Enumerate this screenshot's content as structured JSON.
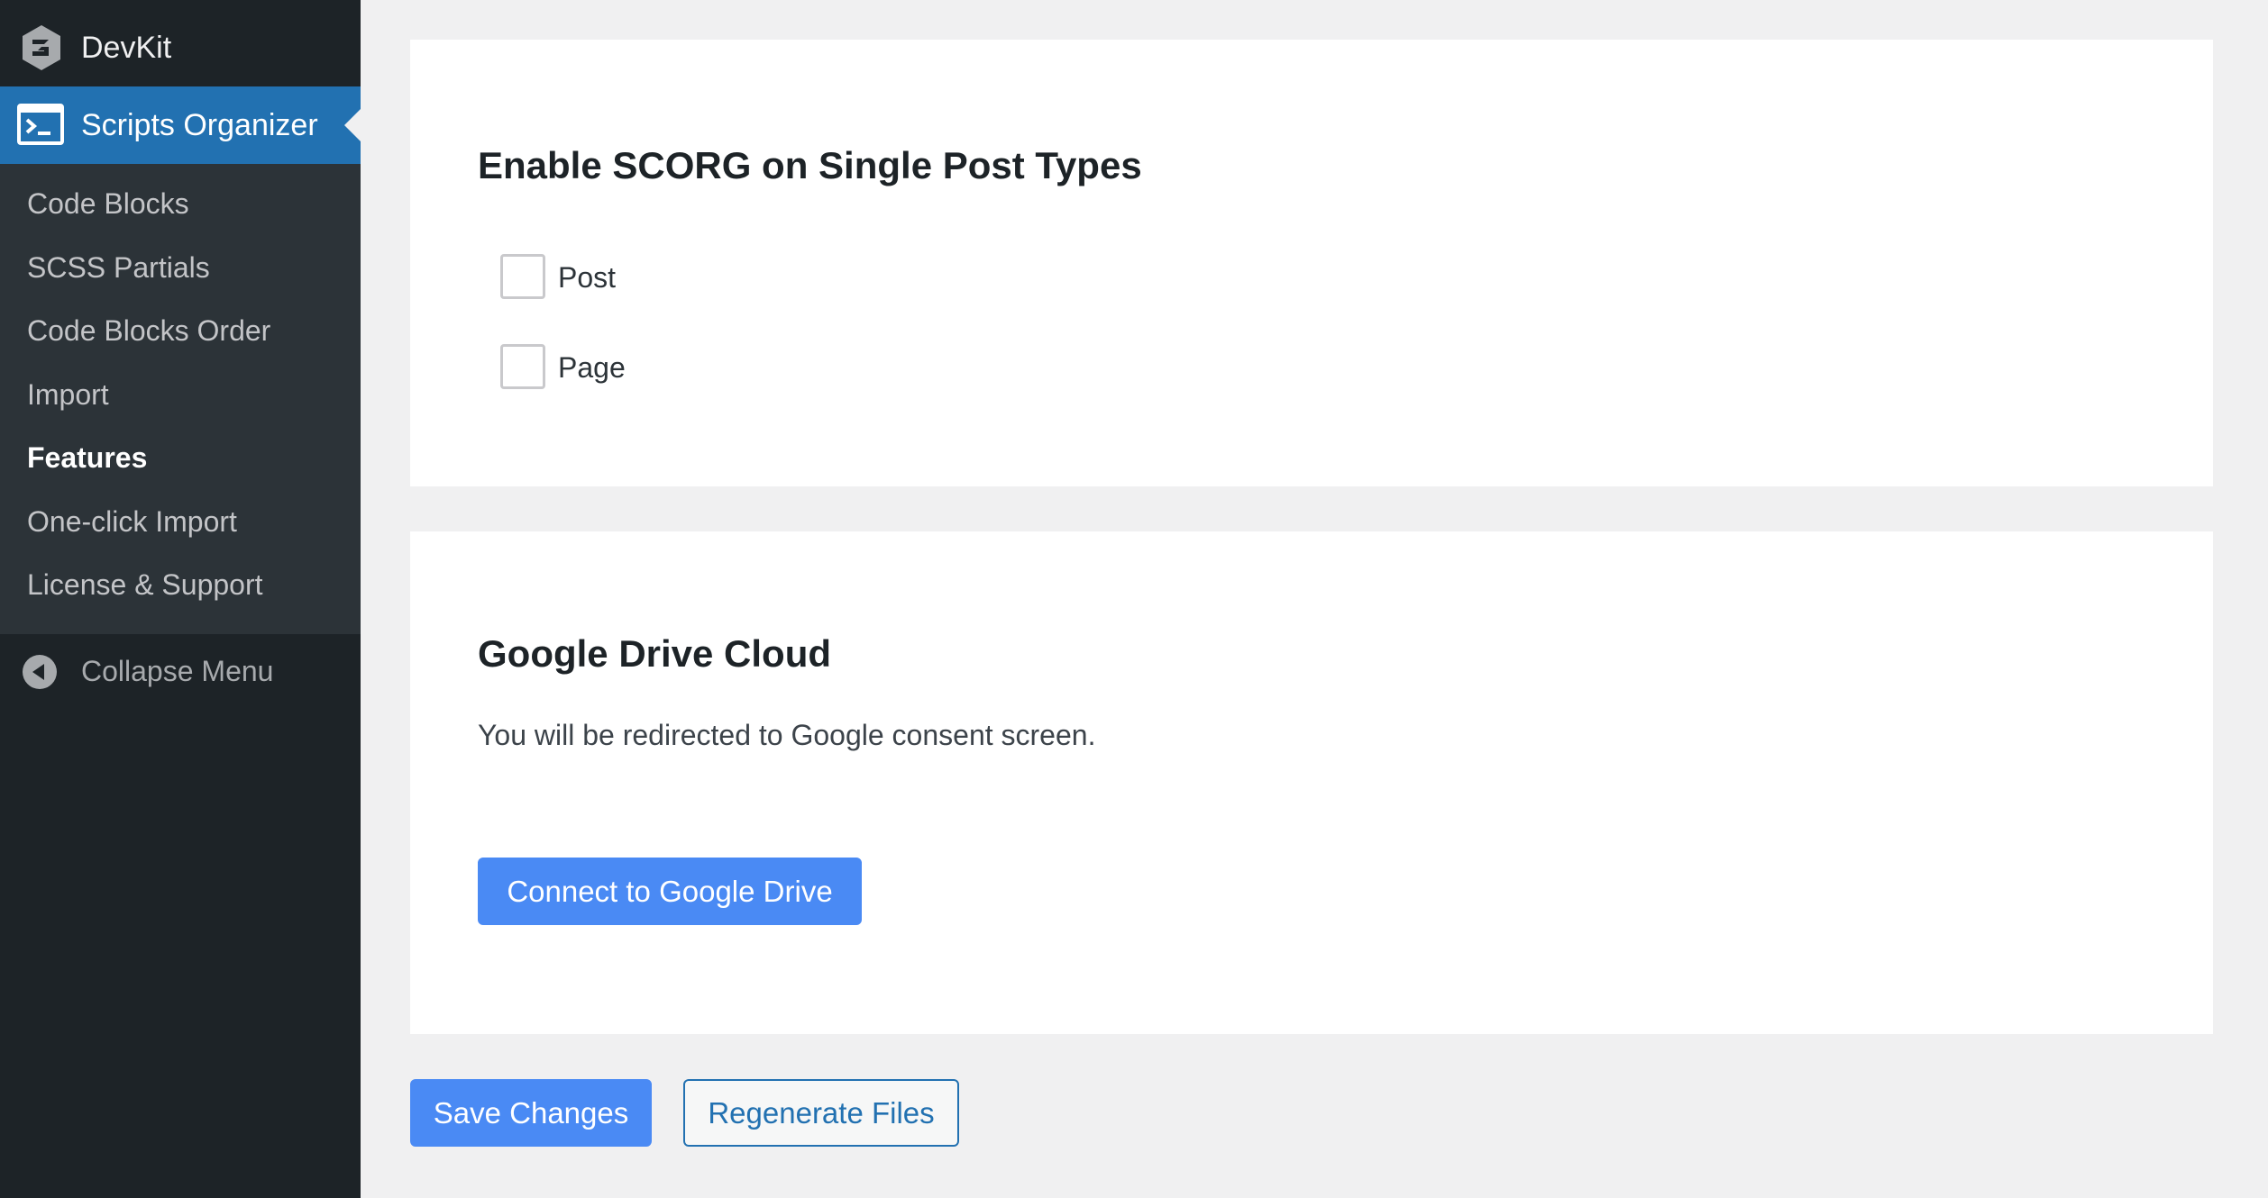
{
  "sidebar": {
    "top_item": {
      "label": "DevKit",
      "icon": "devkit-logo-icon"
    },
    "active_item": {
      "label": "Scripts Organizer",
      "icon": "terminal-icon"
    },
    "submenu": [
      {
        "label": "Code Blocks"
      },
      {
        "label": "SCSS Partials"
      },
      {
        "label": "Code Blocks Order"
      },
      {
        "label": "Import"
      },
      {
        "label": "Features",
        "current": true
      },
      {
        "label": "One-click Import"
      },
      {
        "label": "License & Support"
      }
    ],
    "collapse": {
      "label": "Collapse Menu",
      "icon": "collapse-arrow-icon"
    }
  },
  "single_post_types": {
    "title": "Enable SCORG on Single Post Types",
    "options": [
      {
        "label": "Post",
        "checked": false
      },
      {
        "label": "Page",
        "checked": false
      }
    ]
  },
  "google_drive": {
    "title": "Google Drive Cloud",
    "description": "You will be redirected to Google consent screen.",
    "connect_label": "Connect to Google Drive"
  },
  "actions": {
    "save_label": "Save Changes",
    "regenerate_label": "Regenerate Files"
  },
  "colors": {
    "sidebar_bg": "#1d2327",
    "submenu_bg": "#2c3338",
    "active_bg": "#2271b1",
    "primary_button": "#4a8af4",
    "page_bg": "#f0f0f1"
  }
}
